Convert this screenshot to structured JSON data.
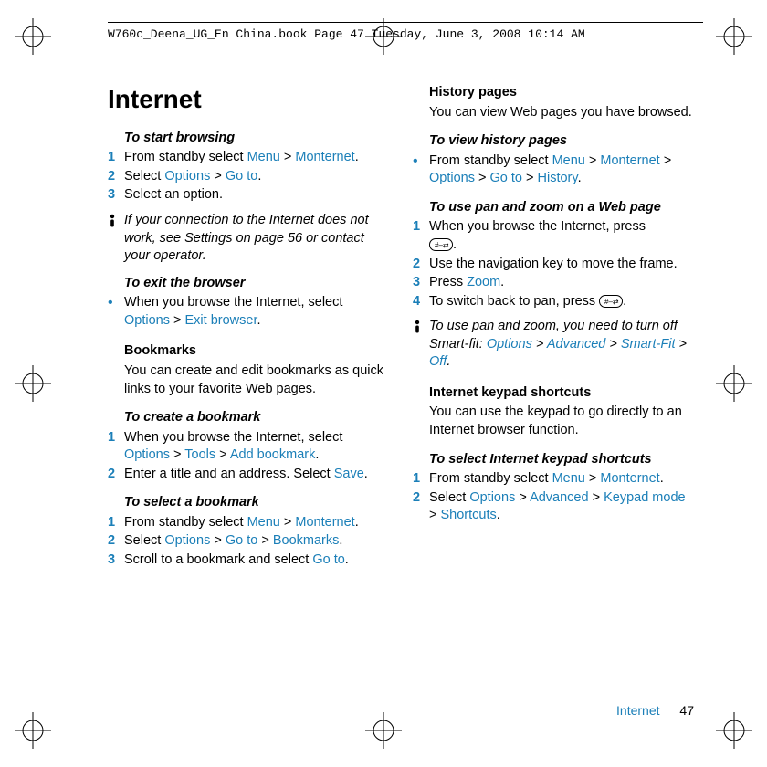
{
  "header": "W760c_Deena_UG_En China.book  Page 47  Tuesday, June 3, 2008  10:14 AM",
  "title": "Internet",
  "left": {
    "start_browsing": {
      "head": "To start browsing",
      "s1a": "From standby select ",
      "s1b": "Menu",
      "s1c": " > ",
      "s1d": "Monternet",
      "s1e": ".",
      "s2a": "Select ",
      "s2b": "Options",
      "s2c": " > ",
      "s2d": "Go to",
      "s2e": ".",
      "s3": "Select an option."
    },
    "note1": "If your connection to the Internet does not work, see Settings on page 56 or contact your operator.",
    "exit": {
      "head": "To exit the browser",
      "b1a": "When you browse the Internet, select ",
      "b1b": "Options",
      "b1c": " > ",
      "b1d": "Exit browser",
      "b1e": "."
    },
    "bookmarks": {
      "head": "Bookmarks",
      "intro": "You can create and edit bookmarks as quick links to your favorite Web pages."
    },
    "create_bm": {
      "head": "To create a bookmark",
      "s1a": "When you browse the Internet, select ",
      "s1b": "Options",
      "s1c": " > ",
      "s1d": "Tools",
      "s1e": " > ",
      "s1f": "Add bookmark",
      "s1g": ".",
      "s2a": "Enter a title and an address. Select ",
      "s2b": "Save",
      "s2c": "."
    },
    "select_bm": {
      "head": "To select a bookmark",
      "s1a": "From standby select ",
      "s1b": "Menu",
      "s1c": " > ",
      "s1d": "Monternet",
      "s1e": ".",
      "s2a": "Select ",
      "s2b": "Options",
      "s2c": " > ",
      "s2d": "Go to",
      "s2e": " > ",
      "s2f": "Bookmarks",
      "s2g": ".",
      "s3a": "Scroll to a bookmark and select ",
      "s3b": "Go to",
      "s3c": "."
    }
  },
  "right": {
    "history": {
      "head": "History pages",
      "intro": "You can view Web pages you have browsed."
    },
    "view_history": {
      "head": "To view history pages",
      "b1a": "From standby select ",
      "b1b": "Menu",
      "b1c": " > ",
      "b1d": "Monternet",
      "b1e": " > ",
      "b1f": "Options",
      "b1g": " > ",
      "b1h": "Go to",
      "b1i": " > ",
      "b1j": "History",
      "b1k": "."
    },
    "pan_zoom": {
      "head": "To use pan and zoom on a Web page",
      "s1a": "When you browse the Internet, press ",
      "s2": "Use the navigation key to move the frame.",
      "s3a": "Press ",
      "s3b": "Zoom",
      "s3c": ".",
      "s4a": "To switch back to pan, press "
    },
    "note2a": "To use pan and zoom, you need to turn off Smart-fit: ",
    "note2_opts": "Options",
    "note2_gt1": " > ",
    "note2_adv": "Advanced",
    "note2_gt2": " > ",
    "note2_sf": "Smart-Fit",
    "note2_gt3": " > ",
    "note2_off": "Off",
    "note2_dot": ".",
    "kps": {
      "head": "Internet keypad shortcuts",
      "intro": "You can use the keypad to go directly to an Internet browser function."
    },
    "select_kps": {
      "head": "To select Internet keypad shortcuts",
      "s1a": "From standby select ",
      "s1b": "Menu",
      "s1c": " > ",
      "s1d": "Monternet",
      "s1e": ".",
      "s2a": "Select ",
      "s2b": "Options",
      "s2c": " > ",
      "s2d": "Advanced",
      "s2e": " > ",
      "s2f": "Keypad mode",
      "s2g": " > ",
      "s2h": "Shortcuts",
      "s2i": "."
    }
  },
  "footer": {
    "category": "Internet",
    "page": "47"
  },
  "num": {
    "n1": "1",
    "n2": "2",
    "n3": "3",
    "n4": "4"
  },
  "bullet": "•",
  "period": "."
}
